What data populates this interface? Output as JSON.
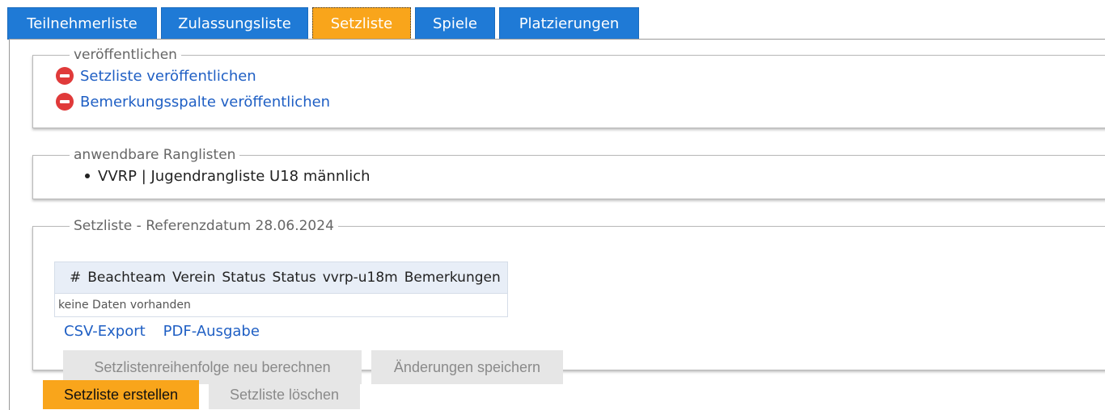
{
  "tabs": [
    {
      "label": "Teilnehmerliste",
      "active": false
    },
    {
      "label": "Zulassungsliste",
      "active": false
    },
    {
      "label": "Setzliste",
      "active": true
    },
    {
      "label": "Spiele",
      "active": false
    },
    {
      "label": "Platzierungen",
      "active": false
    }
  ],
  "publish": {
    "legend": "veröffentlichen",
    "items": [
      {
        "label": "Setzliste veröffentlichen",
        "icon": "minus-circle-icon"
      },
      {
        "label": "Bemerkungsspalte veröffentlichen",
        "icon": "minus-circle-icon"
      }
    ]
  },
  "rankings": {
    "legend": "anwendbare Ranglisten",
    "items": [
      "VVRP | Jugendrangliste U18 männlich"
    ]
  },
  "seeding": {
    "legend": "Setzliste - Referenzdatum 28.06.2024",
    "columns": [
      "#",
      "Beachteam",
      "Verein",
      "Status",
      "Status",
      "vvrp-u18m",
      "Bemerkungen"
    ],
    "empty_text": "keine Daten vorhanden",
    "csv_export": "CSV-Export",
    "pdf_output": "PDF-Ausgabe",
    "recalc_button": "Setzlistenreihenfolge neu berechnen",
    "save_button": "Änderungen speichern"
  },
  "actions": {
    "create_button": "Setzliste erstellen",
    "delete_button": "Setzliste löschen"
  },
  "colors": {
    "tab_blue": "#1f7ad6",
    "tab_active": "#f9a51b",
    "link_blue": "#1f5fc4",
    "minus_red": "#e03a3a"
  }
}
